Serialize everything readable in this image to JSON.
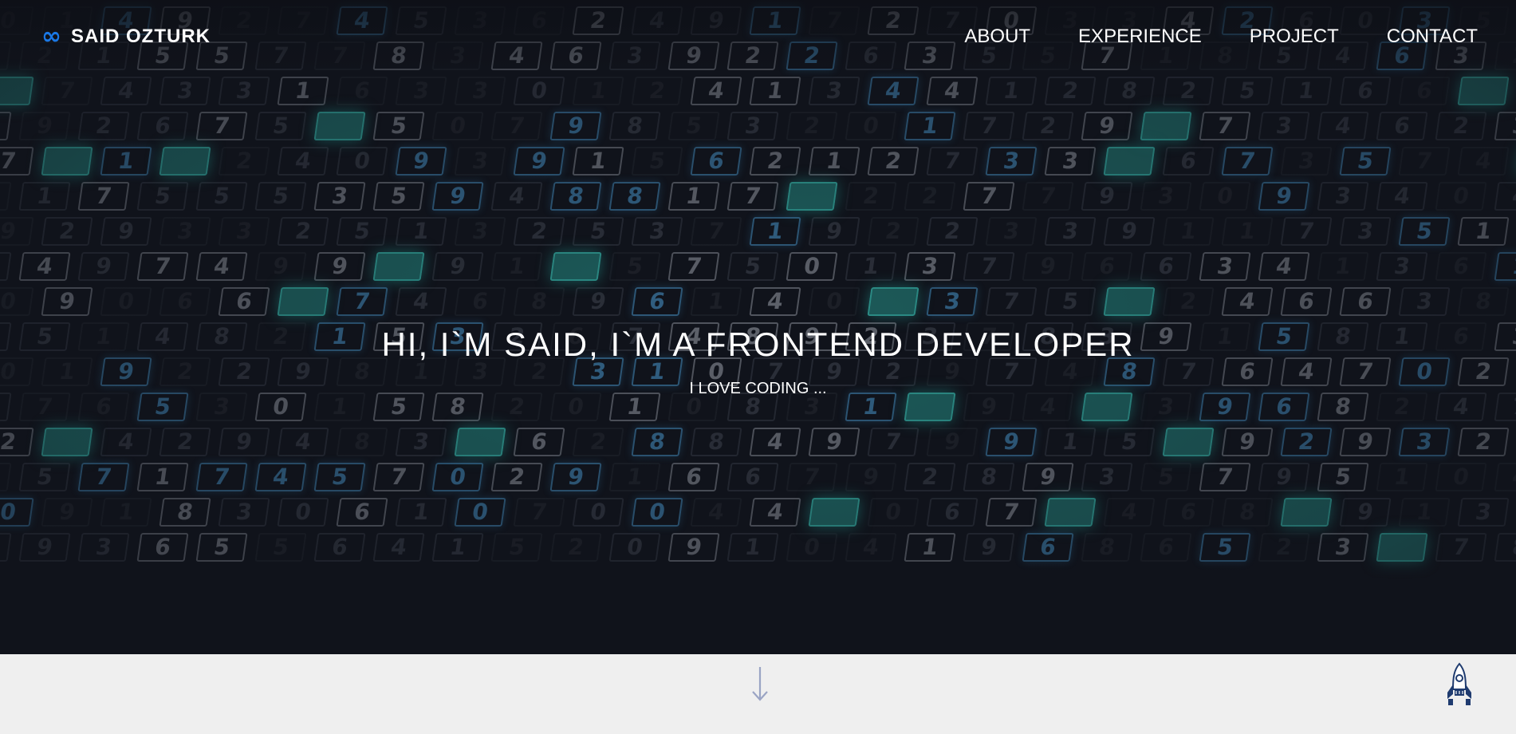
{
  "brand": {
    "icon": "infinity-icon",
    "name": "SAID OZTURK"
  },
  "nav": {
    "items": [
      {
        "label": "ABOUT"
      },
      {
        "label": "EXPERIENCE"
      },
      {
        "label": "PROJECT"
      },
      {
        "label": "CONTACT"
      }
    ]
  },
  "hero": {
    "title": "HI, I`M SAID, I`M A FRONTEND DEVELOPER",
    "subtitle": "I LOVE CODING ..."
  },
  "background": {
    "icon": "digital-number-matrix-background",
    "rows": [
      "0 1 4 9 2 7 4 5 3 6 2 4 9 1 7 2 7 0 3 3 4 2 6 0 3 5 7 1",
      "9 2 1 5 5 7 7 8 3 4 6 3 9 2 2 6 3 5 5 7 1 8 5 4 6 3 2 8",
      "2 7 4 3 3 1 6 3 3 0 1 2 4 1 3 4 4 1 2 8 2 5 1 6 6 1 1 7",
      "3 9 2 6 7 5 6 5 0 7 9 8 5 3 2 0 1 7 2 9 8 7 3 4 6 2 3 8",
      "7 4 1 0 2 4 0 9 3 9 1 5 6 2 1 2 7 3 3 0 6 7 3 5 7 4 1 8",
      "7 1 7 5 5 5 3 5 9 4 8 8 1 7 7 2 2 7 7 9 3 0 9 3 4 0 4 2",
      "9 2 9 3 3 2 5 1 3 2 5 3 7 1 9 2 2 3 3 9 1 1 7 3 5 1 2 5",
      "7 4 9 7 4 9 9 4 9 1 6 5 7 5 0 1 3 7 9 6 6 3 4 1 3 6 1 9",
      "0 9 0 6 6 6 7 4 6 8 9 6 1 4 0 3 3 7 5 9 2 4 6 6 3 8 2 4",
      "6 5 1 4 8 2 1 5 3 2 6 7 4 8 9 2 3 7 8 3 9 1 5 8 1 6 3 7",
      "0 1 9 2 2 9 8 1 3 2 3 1 0 7 9 2 9 7 4 8 7 6 4 7 0 2 2 5",
      "7 7 6 5 3 0 1 5 8 2 0 1 0 8 3 1 9 9 4 1 3 9 6 8 2 4 7 3",
      "2 2 4 2 9 4 8 3 1 6 2 8 8 4 9 7 9 9 1 5 7 9 2 9 3 2 8 2",
      "1 5 7 1 7 4 5 7 0 2 9 1 6 6 7 9 2 8 9 3 5 7 9 5 1 0 4 4",
      "0 9 1 8 3 0 6 1 0 7 0 0 4 4 1 0 6 7 9 4 6 8 7 9 1 3 5 6",
      "6 9 3 6 5 5 6 4 1 5 2 0 9 1 0 4 1 9 6 8 6 5 2 3 0 7 8 1"
    ]
  },
  "scroll_down": {
    "icon": "arrow-down-icon"
  },
  "back_to_top": {
    "icon": "rocket-icon"
  },
  "colors": {
    "hero_background": "#10131b",
    "footer_background": "#efefef",
    "brand_accent": "#1a78e6",
    "arrow": "#9aa4c4",
    "rocket": "#1f3b6f",
    "glow_cells": "#28a096",
    "cyan_cells": "#50aae6"
  }
}
